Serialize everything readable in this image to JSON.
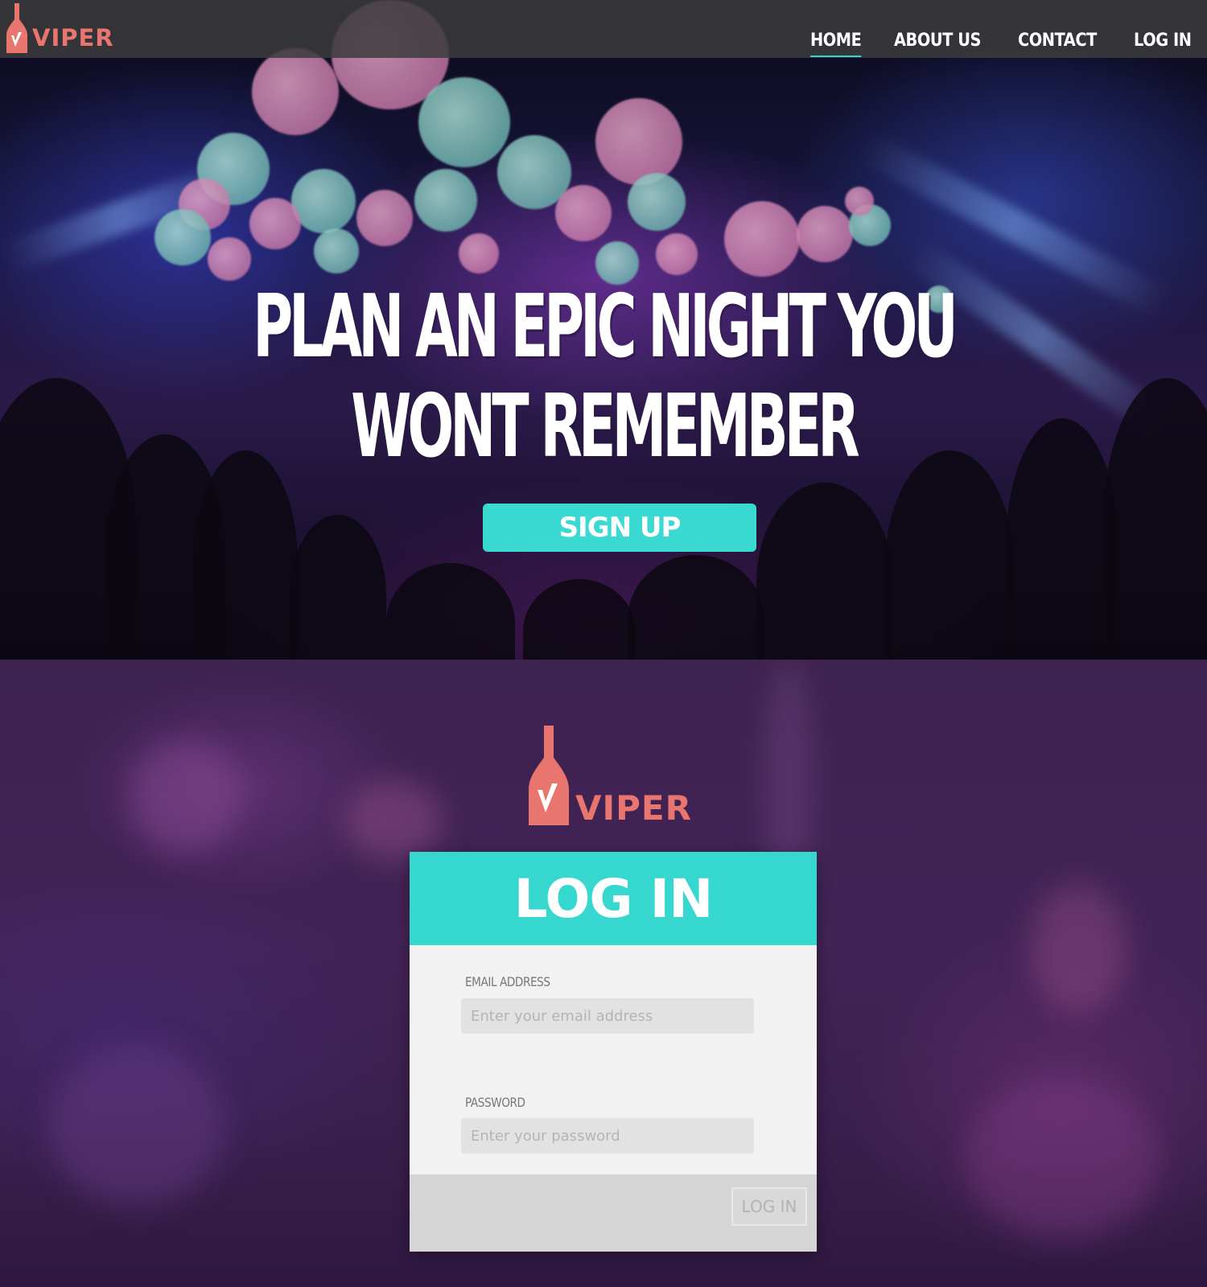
{
  "brand": {
    "name": "VIPER",
    "color": "#e8766f"
  },
  "nav": {
    "items": [
      {
        "label": "HOME",
        "active": true
      },
      {
        "label": "ABOUT US",
        "active": false
      },
      {
        "label": "CONTACT",
        "active": false
      },
      {
        "label": "LOG IN",
        "active": false
      }
    ]
  },
  "hero": {
    "headline_line1": "PLAN AN EPIC NIGHT YOU",
    "headline_line2": "WONT REMEMBER",
    "signup_label": "SIGN UP",
    "accent": "#3ad9d1"
  },
  "login": {
    "title": "LOG IN",
    "email_label": "EMAIL ADDRESS",
    "email_placeholder": "Enter your email address",
    "password_label": "PASSWORD",
    "password_placeholder": "Enter your password",
    "submit_label": "LOG IN"
  }
}
